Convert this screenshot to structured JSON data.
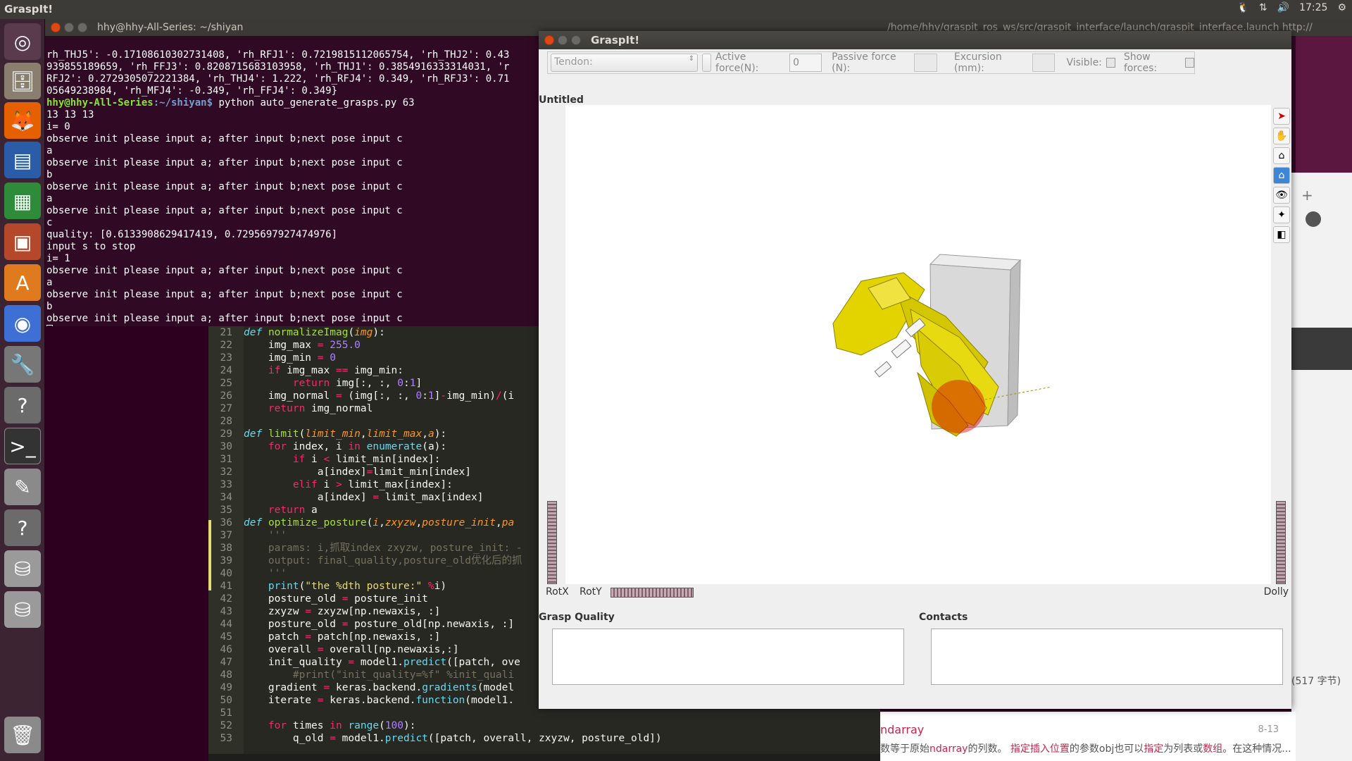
{
  "top_panel": {
    "app_title": "GraspIt!",
    "time": "17:25",
    "tray_icons": [
      "tux-icon",
      "network-arrows-icon",
      "volume-icon",
      "gear-icon"
    ]
  },
  "launcher": {
    "items": [
      "ubuntu-dash-icon",
      "files-icon",
      "firefox-icon",
      "writer-icon",
      "calc-icon",
      "impress-icon",
      "software-center-icon",
      "chrome-icon",
      "settings-icon",
      "help-icon",
      "terminal-icon",
      "text-editor-icon",
      "help-icon-2",
      "disk-icon",
      "disk-icon-2",
      "trash-icon"
    ]
  },
  "terminal": {
    "title": "hhy@hhy-All-Series: ~/shiyan",
    "lines": [
      "rh_THJ5': -0.17108610302731408, 'rh_RFJ1': 0.7219815112065754, 'rh_THJ2': 0.43",
      "939855189659, 'rh_FFJ3': 0.8208715683103958, 'rh_THJ1': 0.3854916333314031, 'r",
      "RFJ2': 0.2729305072221384, 'rh_THJ4': 1.222, 'rh_RFJ4': 0.349, 'rh_RFJ3': 0.71",
      "05649238984, 'rh_MFJ4': -0.349, 'rh_FFJ4': 0.349}"
    ],
    "prompt_user": "hhy@hhy-All-Series",
    "prompt_path": ":~/shiyan$",
    "command": " python auto_generate_grasps.py 63",
    "output": [
      "13 13 13",
      "i= 0",
      "observe init please input a; after input b;next pose input c",
      "a",
      "observe init please input a; after input b;next pose input c",
      "b",
      "observe init please input a; after input b;next pose input c",
      "a",
      "observe init please input a; after input b;next pose input c",
      "c",
      "quality: [0.6133908629417419, 0.7295697927474976]",
      "input s to stop",
      "i= 1",
      "observe init please input a; after input b;next pose input c",
      "a",
      "observe init please input a; after input b;next pose input c",
      "b",
      "observe init please input a; after input b;next pose input c"
    ]
  },
  "bg_terminal": {
    "title": "/home/hhy/graspit_ros_ws/src/graspit_interface/launch/graspit_interface.launch http://"
  },
  "editor": {
    "lines": [
      {
        "n": "21",
        "html": "<span class='kw'>def</span> <span class='fn'>normalizeImag</span>(<span class='arg'>img</span>):"
      },
      {
        "n": "22",
        "html": "    img_max <span class='kw2'>=</span> <span class='num'>255.0</span>"
      },
      {
        "n": "23",
        "html": "    img_min <span class='kw2'>=</span> <span class='num'>0</span>"
      },
      {
        "n": "24",
        "html": "    <span class='kw2'>if</span> img_max <span class='kw2'>==</span> img_min:"
      },
      {
        "n": "25",
        "html": "        <span class='kw2'>return</span> img[:, :, <span class='num'>0</span>:<span class='num'>1</span>]"
      },
      {
        "n": "26",
        "html": "    img_normal <span class='kw2'>=</span> (img[:, :, <span class='num'>0</span>:<span class='num'>1</span>]<span class='kw2'>-</span>img_min)<span class='kw2'>/</span>(i"
      },
      {
        "n": "27",
        "html": "    <span class='kw2'>return</span> img_normal"
      },
      {
        "n": "28",
        "html": ""
      },
      {
        "n": "29",
        "html": "<span class='kw'>def</span> <span class='fn'>limit</span>(<span class='arg'>limit_min</span>,<span class='arg'>limit_max</span>,<span class='arg'>a</span>):"
      },
      {
        "n": "30",
        "html": "    <span class='kw2'>for</span> index, i <span class='kw2'>in</span> <span class='bi'>enumerate</span>(a):"
      },
      {
        "n": "31",
        "html": "        <span class='kw2'>if</span> i <span class='kw2'>&lt;</span> limit_min[index]:"
      },
      {
        "n": "32",
        "html": "            a[index]<span class='kw2'>=</span>limit_min[index]"
      },
      {
        "n": "33",
        "html": "        <span class='kw2'>elif</span> i <span class='kw2'>&gt;</span> limit_max[index]:"
      },
      {
        "n": "34",
        "html": "            a[index] <span class='kw2'>=</span> limit_max[index]"
      },
      {
        "n": "35",
        "html": "    <span class='kw2'>return</span> a"
      },
      {
        "n": "36",
        "html": "<span class='kw'>def</span> <span class='fn'>optimize_posture</span>(<span class='arg'>i</span>,<span class='arg'>zxyzw</span>,<span class='arg'>posture_init</span>,<span class='arg'>pa</span>"
      },
      {
        "n": "37",
        "html": "    <span class='cm'>'''</span>"
      },
      {
        "n": "38",
        "html": "    <span class='cm'>params: i,抓取index zxyzw, posture_init: -</span>"
      },
      {
        "n": "39",
        "html": "    <span class='cm'>output: final_quality,posture_old优化后的抓</span>"
      },
      {
        "n": "40",
        "html": "    <span class='cm'>'''</span>"
      },
      {
        "n": "41",
        "html": "    <span class='bi'>print</span>(<span class='str'>\"the %dth posture:\"</span> <span class='kw2'>%</span>i)"
      },
      {
        "n": "42",
        "html": "    posture_old <span class='kw2'>=</span> posture_init"
      },
      {
        "n": "43",
        "html": "    zxyzw <span class='kw2'>=</span> zxyzw[np.newaxis, :]"
      },
      {
        "n": "44",
        "html": "    posture_old <span class='kw2'>=</span> posture_old[np.newaxis, :]"
      },
      {
        "n": "45",
        "html": "    patch <span class='kw2'>=</span> patch[np.newaxis, :]"
      },
      {
        "n": "46",
        "html": "    overall <span class='kw2'>=</span> overall[np.newaxis,:]"
      },
      {
        "n": "47",
        "html": "    init_quality <span class='kw2'>=</span> model1.<span class='bi'>predict</span>([patch, ove"
      },
      {
        "n": "48",
        "html": "        <span class='cm'>#print(\"init_quality=%f\" %init_quali</span>"
      },
      {
        "n": "49",
        "html": "    gradient <span class='kw2'>=</span> keras.backend.<span class='bi'>gradients</span>(model"
      },
      {
        "n": "50",
        "html": "    iterate <span class='kw2'>=</span> keras.backend.<span class='bi'>function</span>(model1."
      },
      {
        "n": "51",
        "html": ""
      },
      {
        "n": "52",
        "html": "    <span class='kw2'>for</span> times <span class='kw2'>in</span> <span class='bi'>range</span>(<span class='num'>100</span>):"
      },
      {
        "n": "53",
        "html": "        q_old <span class='kw2'>=</span> model1.<span class='bi'>predict</span>([patch, overall, zxyzw, posture_old])"
      }
    ]
  },
  "browser": {
    "bytes": "(517 字节)",
    "title": "ndarray",
    "date": "8-13",
    "desc_parts": [
      "数等于原始",
      "ndarray",
      "的列数。 ",
      "指定插入位置",
      "的参数obj也可以",
      "指定",
      "为列表或",
      "数组",
      "。在这种情况..."
    ]
  },
  "graspit": {
    "title": "GraspIt!",
    "toolbar": {
      "tendon_label": "Tendon:",
      "active_force_label": "Active force(N):",
      "active_force_value": "0",
      "passive_force_label": "Passive force (N):",
      "excursion_label": "Excursion (mm):",
      "visible_label": "Visible:",
      "show_forces_label": "Show forces:"
    },
    "document_title": "Untitled",
    "viewer_tools": [
      "select-arrow-icon",
      "hand-pan-icon",
      "home-view-icon",
      "set-home-icon",
      "eye-view-all-icon",
      "seek-icon",
      "perspective-icon"
    ],
    "rot_x": "RotX",
    "rot_y": "RotY",
    "dolly": "Dolly",
    "grasp_quality_label": "Grasp Quality",
    "contacts_label": "Contacts"
  }
}
